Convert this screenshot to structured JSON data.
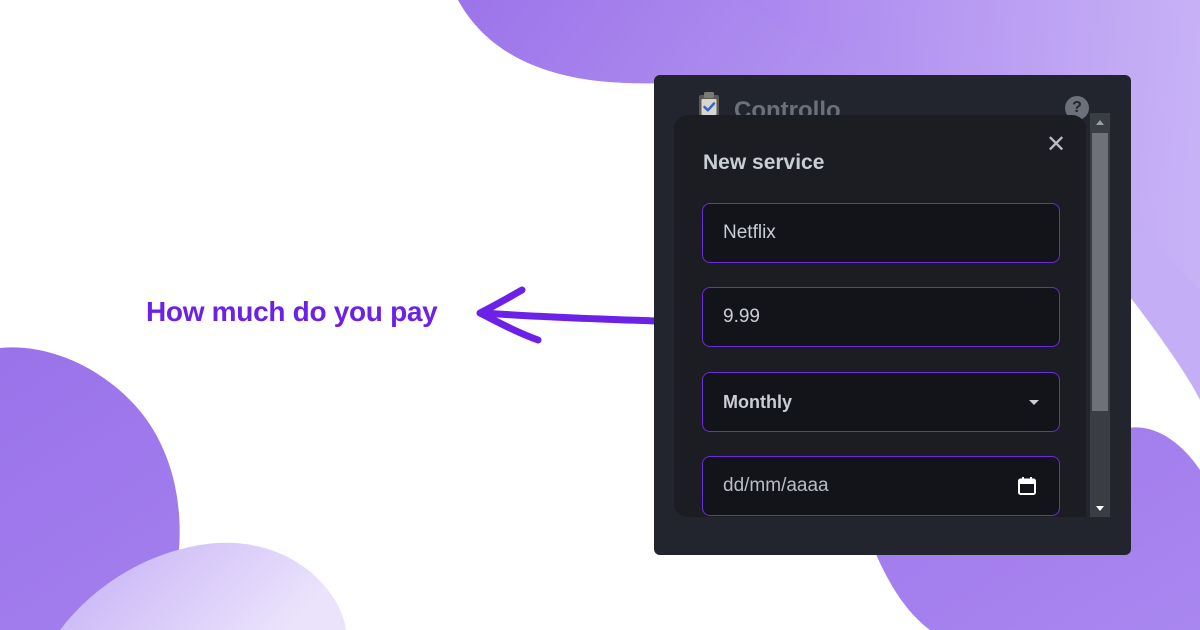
{
  "callout": {
    "text": "How much do you pay"
  },
  "app": {
    "title": "Controllo",
    "logo_icon": "clipboard-check-icon",
    "help_icon": "question-circle-icon",
    "help_glyph": "?"
  },
  "modal": {
    "title": "New service",
    "close_glyph": "✕",
    "fields": {
      "name_value": "Netflix",
      "price_value": "9.99",
      "billing_cycle_value": "Monthly",
      "date_placeholder": "dd/mm/aaaa"
    }
  },
  "colors": {
    "accent": "#6b21e8",
    "window_bg": "#22252d",
    "modal_bg": "#1b1d23",
    "field_border": "#6c2bd9",
    "blob_purple": "#9b72ea"
  }
}
